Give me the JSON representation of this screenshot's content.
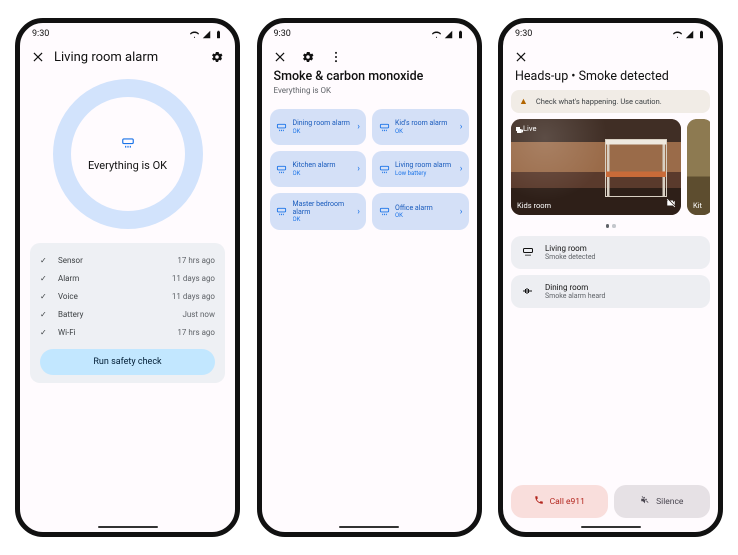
{
  "status": {
    "time": "9:30"
  },
  "phone1": {
    "title": "Living room alarm",
    "status_text": "Everything is OK",
    "checks": [
      {
        "label": "Sensor",
        "time": "17 hrs ago"
      },
      {
        "label": "Alarm",
        "time": "11 days ago"
      },
      {
        "label": "Voice",
        "time": "11 days ago"
      },
      {
        "label": "Battery",
        "time": "Just now"
      },
      {
        "label": "Wi-Fi",
        "time": "17 hrs ago"
      }
    ],
    "safety_button": "Run safety check"
  },
  "phone2": {
    "title": "Smoke & carbon monoxide",
    "subtitle": "Everything is OK",
    "alarms": [
      {
        "name": "Dining room alarm",
        "status": "OK"
      },
      {
        "name": "Kid's room alarm",
        "status": "OK"
      },
      {
        "name": "Kitchen alarm",
        "status": "OK"
      },
      {
        "name": "Living room alarm",
        "status": "Low battery"
      },
      {
        "name": "Master bedroom alarm",
        "status": "OK"
      },
      {
        "name": "Office alarm",
        "status": "OK"
      }
    ]
  },
  "phone3": {
    "title": "Heads-up • Smoke detected",
    "warning": "Check what's happening. Use caution.",
    "camera": {
      "live_label": "Live",
      "room_label": "Kids room",
      "peek_label": "Kit"
    },
    "detections": [
      {
        "room": "Living room",
        "status": "Smoke detected"
      },
      {
        "room": "Dining room",
        "status": "Smoke alarm heard"
      }
    ],
    "call_label": "Call e911",
    "silence_label": "Silence"
  }
}
